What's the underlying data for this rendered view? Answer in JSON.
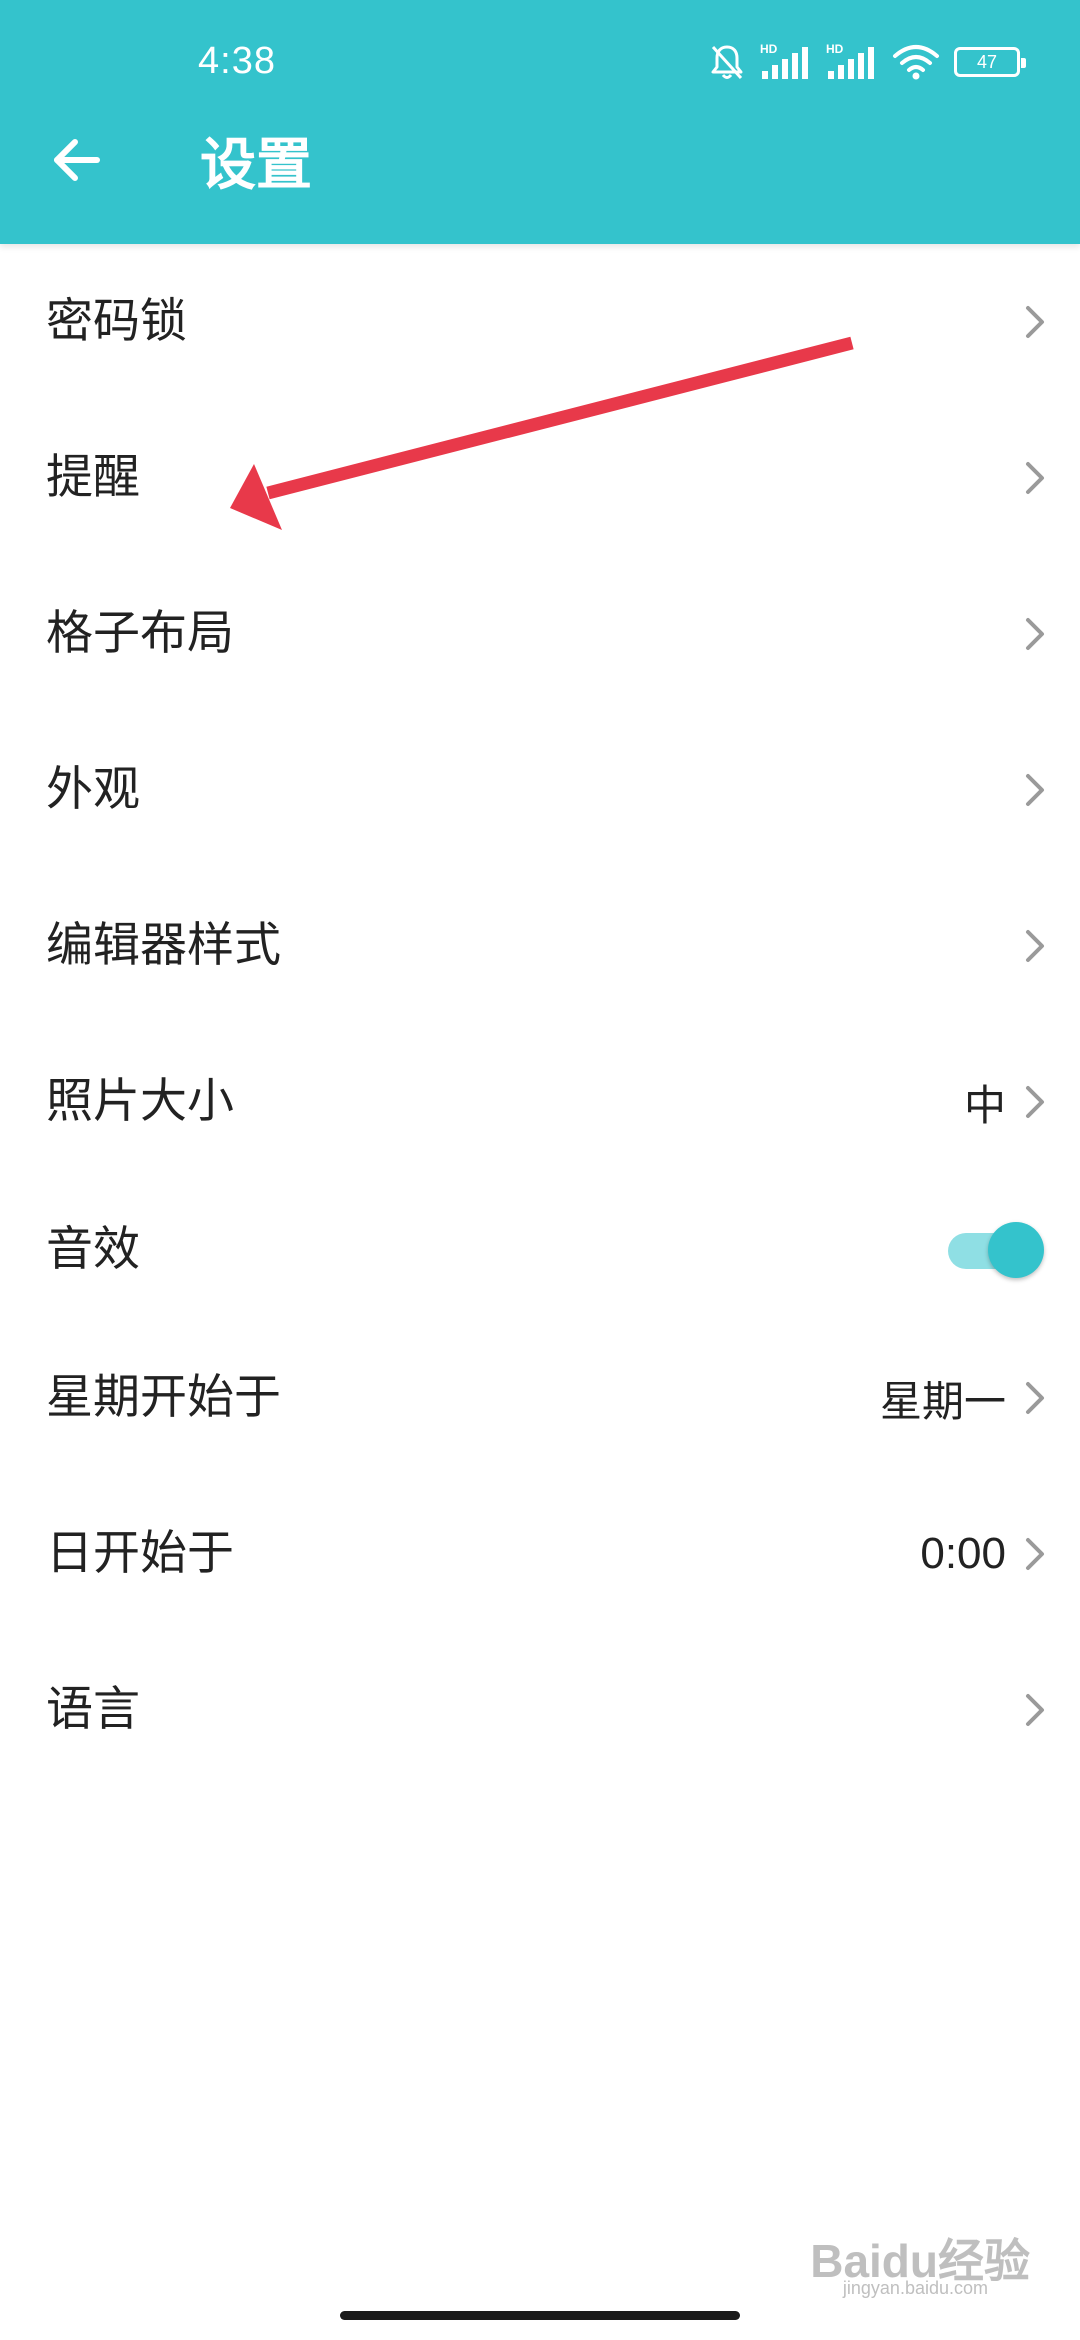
{
  "status_bar": {
    "time": "4:38",
    "battery": "47",
    "signal1_label": "HD",
    "signal2_label": "HD"
  },
  "header": {
    "title": "设置",
    "back_icon": "arrow-left-icon",
    "background_color": "#34c3cc"
  },
  "settings": {
    "items": [
      {
        "label": "密码锁",
        "value": "",
        "control": "chevron"
      },
      {
        "label": "提醒",
        "value": "",
        "control": "chevron"
      },
      {
        "label": "格子布局",
        "value": "",
        "control": "chevron"
      },
      {
        "label": "外观",
        "value": "",
        "control": "chevron"
      },
      {
        "label": "编辑器样式",
        "value": "",
        "control": "chevron"
      },
      {
        "label": "照片大小",
        "value": "中",
        "control": "chevron"
      },
      {
        "label": "音效",
        "value": "",
        "control": "toggle",
        "toggle_on": true
      },
      {
        "label": "星期开始于",
        "value": "星期一",
        "control": "chevron"
      },
      {
        "label": "日开始于",
        "value": "0:00",
        "control": "chevron"
      },
      {
        "label": "语言",
        "value": "",
        "control": "chevron"
      }
    ]
  },
  "annotation": {
    "arrow_color": "#e8394a",
    "points_to": "提醒"
  },
  "watermark": {
    "text": "Baidu经验",
    "sub": "jingyan.baidu.com"
  }
}
